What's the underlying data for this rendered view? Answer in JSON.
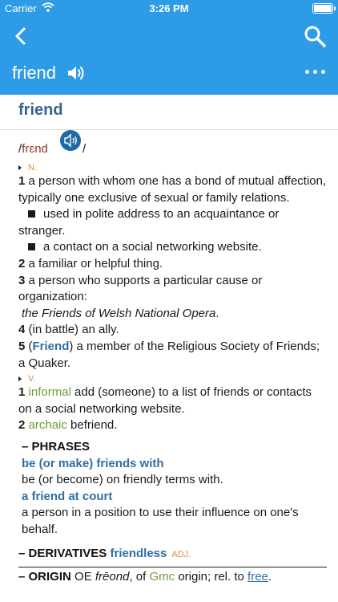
{
  "status": {
    "carrier": "Carrier",
    "time": "3:26 PM"
  },
  "nav": {
    "title": "friend"
  },
  "entry": {
    "headword": "friend",
    "pronunciation": {
      "open": "/",
      "text": "frɛnd",
      "close": "/"
    },
    "noun": {
      "pos": "N.",
      "s1_num": "1",
      "s1_text": "a person with whom one has a bond of mutual affection, typically one exclusive of sexual or family relations.",
      "s1_sub1": "used in polite address to an acquaintance or stranger.",
      "s1_sub2": "a contact on a social networking website.",
      "s2_num": "2",
      "s2_text": "a familiar or helpful thing.",
      "s3_num": "3",
      "s3_text": "a person who supports a particular cause or organization:",
      "s3_example": "the Friends of Welsh National Opera",
      "s3_example_end": ".",
      "s4_num": "4",
      "s4_text": "(in battle) an ally.",
      "s5_num": "5",
      "s5_open": "(",
      "s5_label": "Friend",
      "s5_text": ") a member of the Religious Society of Friends; a Quaker."
    },
    "verb": {
      "pos": "V.",
      "s1_num": "1",
      "s1_label": "informal",
      "s1_text": "add (someone) to a list of friends or contacts on a social networking website.",
      "s2_num": "2",
      "s2_label": "archaic",
      "s2_text": "befriend."
    },
    "phrases": {
      "label": "– PHRASES",
      "p1_term": "be (or make) friends with",
      "p1_def": "be (or become) on friendly terms with.",
      "p2_term": "a friend at court",
      "p2_def": "a person in a position to use their influence on one's behalf."
    },
    "derivatives": {
      "label": "– DERIVATIVES",
      "word": "friendless",
      "pos": "ADJ."
    },
    "origin": {
      "label": "– ORIGIN",
      "t1": "OE",
      "t2": "frēond",
      "t3": ", of",
      "t4": "Gmc",
      "t5": "origin; rel. to",
      "t6": "free",
      "t7": "."
    }
  }
}
